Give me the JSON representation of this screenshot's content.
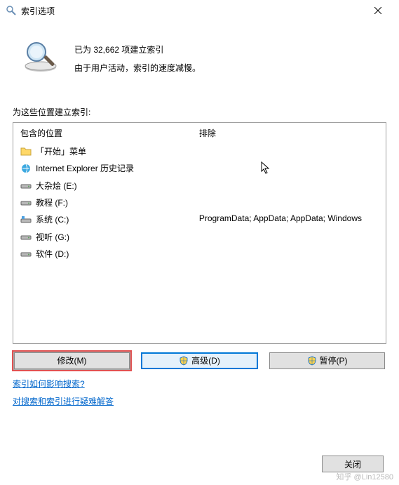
{
  "title": "索引选项",
  "status": {
    "line1": "已为 32,662 项建立索引",
    "line2": "由于用户活动，索引的速度减慢。"
  },
  "section_label": "为这些位置建立索引:",
  "columns": {
    "included_header": "包含的位置",
    "excluded_header": "排除"
  },
  "locations": [
    {
      "icon": "folder-icon",
      "label": "「开始」菜单"
    },
    {
      "icon": "ie-icon",
      "label": "Internet Explorer 历史记录"
    },
    {
      "icon": "drive-icon",
      "label": "大杂烩 (E:)"
    },
    {
      "icon": "drive-icon",
      "label": "教程 (F:)"
    },
    {
      "icon": "system-drive-icon",
      "label": "系统 (C:)"
    },
    {
      "icon": "drive-icon",
      "label": "视听 (G:)"
    },
    {
      "icon": "drive-icon",
      "label": "软件 (D:)"
    }
  ],
  "exclusions_text": "ProgramData; AppData; AppData; Windows",
  "buttons": {
    "modify": "修改(M)",
    "advanced": "高级(D)",
    "pause": "暂停(P)",
    "close": "关闭"
  },
  "links": {
    "help1": "索引如何影响搜索?",
    "help2": "对搜索和索引进行疑难解答"
  },
  "watermark": "知乎 @Lin12580"
}
